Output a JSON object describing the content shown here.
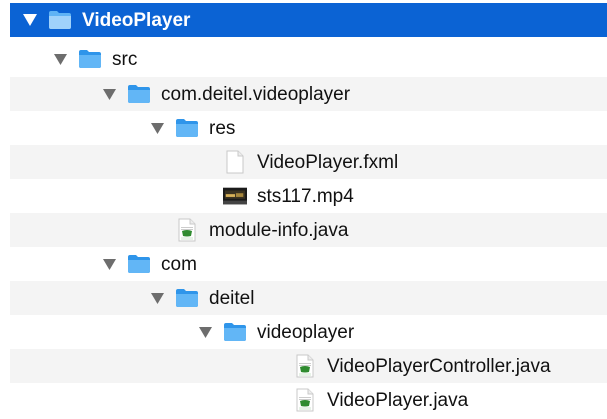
{
  "colors": {
    "selected_bg": "#0b63d4",
    "alt_row_bg": "#f4f4f4",
    "folder_blue": "#3aa3f2",
    "java_green": "#2f8b2f"
  },
  "tree": {
    "items": [
      {
        "label": "VideoPlayer",
        "type": "folder",
        "expanded": true,
        "icon": "folder-icon"
      },
      {
        "label": "src",
        "type": "folder",
        "expanded": true,
        "icon": "folder-icon"
      },
      {
        "label": "com.deitel.videoplayer",
        "type": "folder",
        "expanded": true,
        "icon": "folder-icon"
      },
      {
        "label": "res",
        "type": "folder",
        "expanded": true,
        "icon": "folder-icon"
      },
      {
        "label": "VideoPlayer.fxml",
        "type": "file",
        "icon": "document-icon"
      },
      {
        "label": "sts117.mp4",
        "type": "file",
        "icon": "video-thumbnail-icon"
      },
      {
        "label": "module-info.java",
        "type": "file",
        "icon": "java-file-icon"
      },
      {
        "label": "com",
        "type": "folder",
        "expanded": true,
        "icon": "folder-icon"
      },
      {
        "label": "deitel",
        "type": "folder",
        "expanded": true,
        "icon": "folder-icon"
      },
      {
        "label": "videoplayer",
        "type": "folder",
        "expanded": true,
        "icon": "folder-icon"
      },
      {
        "label": "VideoPlayerController.java",
        "type": "file",
        "icon": "java-file-icon"
      },
      {
        "label": "VideoPlayer.java",
        "type": "file",
        "icon": "java-file-icon"
      }
    ]
  }
}
